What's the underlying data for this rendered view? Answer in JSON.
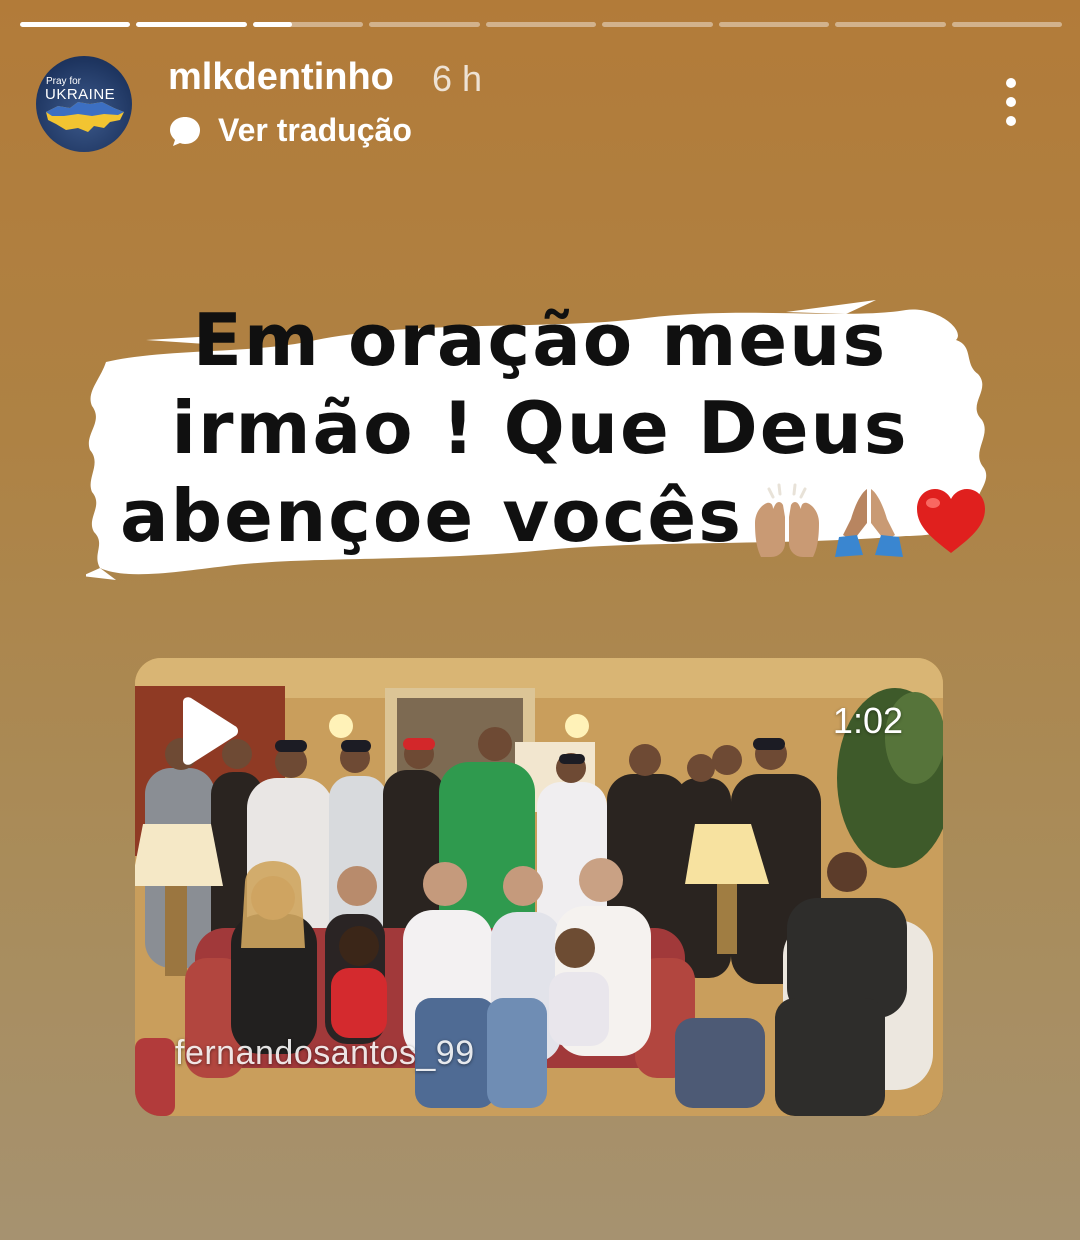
{
  "story": {
    "progress": {
      "segments": [
        1,
        1,
        0.35,
        0,
        0,
        0,
        0,
        0,
        0
      ],
      "active_index": 2
    },
    "author": {
      "username": "mlkdentinho",
      "time_ago": "6 h",
      "avatar": {
        "line1": "Pray for",
        "line2": "UKRAINE"
      }
    },
    "translate_label": "Ver tradução",
    "caption": {
      "line1": "Em oração meus",
      "line2": "irmão !  Que Deus",
      "line3": "abençoe vocês",
      "emojis": [
        "raising-hands-emoji",
        "folded-hands-emoji",
        "red-heart-emoji"
      ]
    },
    "video": {
      "duration": "1:02",
      "watermark": "fernandosantos_99"
    }
  }
}
